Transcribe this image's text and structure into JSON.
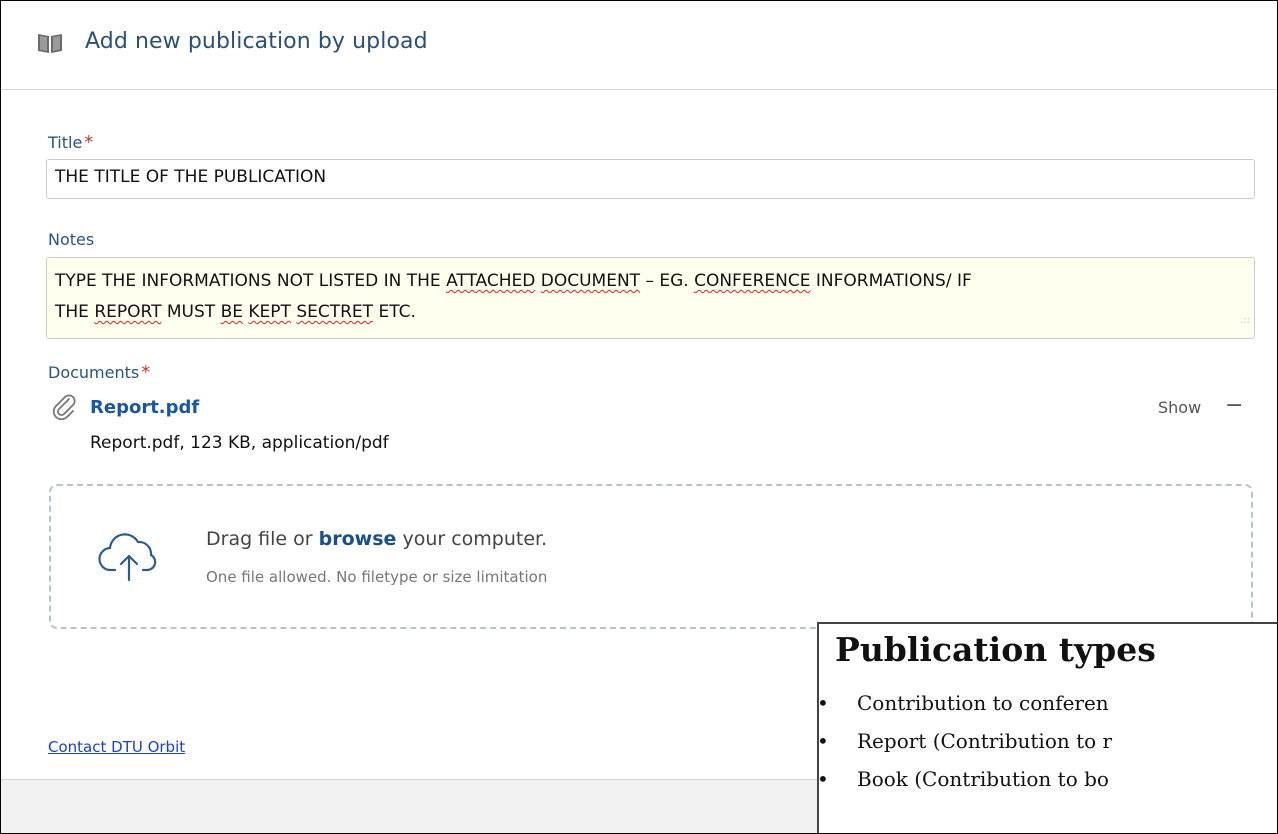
{
  "header": {
    "title": "Add new publication by upload",
    "icon": "book-icon"
  },
  "form": {
    "title_label": "Title",
    "required_mark": "*",
    "title_value": "THE TITLE OF THE PUBLICATION",
    "notes_label": "Notes",
    "notes_line1_a": "TYPE THE INFORMATIONS NOT LISTED IN THE ",
    "notes_w_attached": "ATTACHED",
    "notes_sp1": " ",
    "notes_w_document": "DOCUMENT",
    "notes_line1_b": " – EG. ",
    "notes_w_conference": "CONFERENCE",
    "notes_line1_c": " INFORMATIONS/ IF",
    "notes_line2_a": "THE ",
    "notes_w_report": "REPORT",
    "notes_line2_b": " MUST ",
    "notes_w_be": "BE",
    "notes_sp2": " ",
    "notes_w_kept": "KEPT",
    "notes_sp3": " ",
    "notes_w_sectret": "SECTRET",
    "notes_line2_c": " ETC.",
    "documents_label": "Documents"
  },
  "document": {
    "name": "Report.pdf",
    "meta": "Report.pdf, 123 KB, application/pdf",
    "show_label": "Show",
    "remove_label": "−"
  },
  "dropzone": {
    "text_before": "Drag file or ",
    "browse_label": "browse",
    "text_after": " your computer.",
    "subtext": "One file allowed. No filetype or size limitation"
  },
  "footer": {
    "contact_label": "Contact DTU Orbit"
  },
  "overlay": {
    "heading": "Publication types",
    "items": [
      "Contribution to conferen",
      "Report (Contribution to r",
      "Book (Contribution to bo"
    ]
  },
  "colors": {
    "link": "#1a56a6",
    "label": "#2b5380",
    "required": "#c0392b",
    "notes_bg": "#fffff0"
  }
}
